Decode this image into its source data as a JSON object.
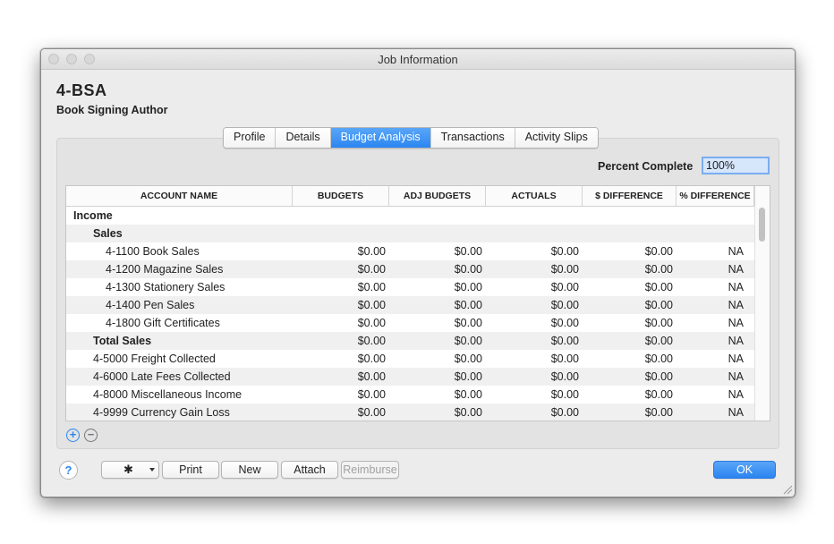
{
  "window": {
    "title": "Job Information"
  },
  "job": {
    "code": "4-BSA",
    "name": "Book Signing Author"
  },
  "tabs": [
    "Profile",
    "Details",
    "Budget Analysis",
    "Transactions",
    "Activity Slips"
  ],
  "active_tab": "Budget Analysis",
  "percent_complete": {
    "label": "Percent Complete",
    "value": "100%"
  },
  "table": {
    "columns": [
      "ACCOUNT NAME",
      "BUDGETS",
      "ADJ BUDGETS",
      "ACTUALS",
      "$ DIFFERENCE",
      "% DIFFERENCE"
    ],
    "rows": [
      {
        "label": "Income",
        "level": 0,
        "bold": true
      },
      {
        "label": "Sales",
        "level": 1,
        "bold": true
      },
      {
        "label": "4-1100  Book Sales",
        "level": 2,
        "budgets": "$0.00",
        "adj_budgets": "$0.00",
        "actuals": "$0.00",
        "diff": "$0.00",
        "pct_diff": "NA"
      },
      {
        "label": "4-1200  Magazine Sales",
        "level": 2,
        "budgets": "$0.00",
        "adj_budgets": "$0.00",
        "actuals": "$0.00",
        "diff": "$0.00",
        "pct_diff": "NA"
      },
      {
        "label": "4-1300  Stationery Sales",
        "level": 2,
        "budgets": "$0.00",
        "adj_budgets": "$0.00",
        "actuals": "$0.00",
        "diff": "$0.00",
        "pct_diff": "NA"
      },
      {
        "label": "4-1400  Pen Sales",
        "level": 2,
        "budgets": "$0.00",
        "adj_budgets": "$0.00",
        "actuals": "$0.00",
        "diff": "$0.00",
        "pct_diff": "NA"
      },
      {
        "label": "4-1800  Gift Certificates",
        "level": 2,
        "budgets": "$0.00",
        "adj_budgets": "$0.00",
        "actuals": "$0.00",
        "diff": "$0.00",
        "pct_diff": "NA"
      },
      {
        "label": "Total Sales",
        "level": 1,
        "bold": true,
        "budgets": "$0.00",
        "adj_budgets": "$0.00",
        "actuals": "$0.00",
        "diff": "$0.00",
        "pct_diff": "NA"
      },
      {
        "label": "4-5000  Freight Collected",
        "level": 1,
        "budgets": "$0.00",
        "adj_budgets": "$0.00",
        "actuals": "$0.00",
        "diff": "$0.00",
        "pct_diff": "NA"
      },
      {
        "label": "4-6000  Late Fees Collected",
        "level": 1,
        "budgets": "$0.00",
        "adj_budgets": "$0.00",
        "actuals": "$0.00",
        "diff": "$0.00",
        "pct_diff": "NA"
      },
      {
        "label": "4-8000  Miscellaneous Income",
        "level": 1,
        "budgets": "$0.00",
        "adj_budgets": "$0.00",
        "actuals": "$0.00",
        "diff": "$0.00",
        "pct_diff": "NA"
      },
      {
        "label": "4-9999  Currency Gain Loss",
        "level": 1,
        "budgets": "$0.00",
        "adj_budgets": "$0.00",
        "actuals": "$0.00",
        "diff": "$0.00",
        "pct_diff": "NA"
      }
    ]
  },
  "icons": {
    "add": "plus-circle-icon",
    "remove": "minus-circle-icon",
    "help": "question-icon",
    "gear": "gear-icon"
  },
  "footer": {
    "help_glyph": "?",
    "add_glyph": "+",
    "remove_glyph": "−",
    "gear_glyph": "✱",
    "print_label": "Print",
    "new_label": "New",
    "attach_label": "Attach",
    "reimburse_label": "Reimburse",
    "ok_label": "OK"
  },
  "colors": {
    "accent": "#2b86f0",
    "panel": "#e3e3e3",
    "window": "#ececec"
  }
}
